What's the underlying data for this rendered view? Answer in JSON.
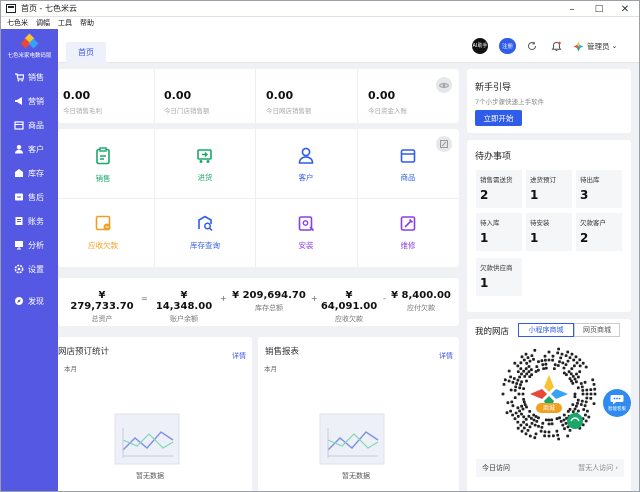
{
  "window": {
    "title": "首页 - 七色米云"
  },
  "menubar": [
    "七色米",
    "调幅",
    "工具",
    "帮助"
  ],
  "brand": {
    "name": "七色米家电数码版"
  },
  "sidebar": {
    "items": [
      {
        "label": "销售",
        "icon": "cart-icon"
      },
      {
        "label": "营销",
        "icon": "megaphone-icon"
      },
      {
        "label": "商品",
        "icon": "box-icon"
      },
      {
        "label": "客户",
        "icon": "user-icon"
      },
      {
        "label": "库存",
        "icon": "warehouse-icon"
      },
      {
        "label": "售后",
        "icon": "service-icon"
      },
      {
        "label": "账务",
        "icon": "ledger-icon"
      },
      {
        "label": "分析",
        "icon": "chart-icon"
      },
      {
        "label": "设置",
        "icon": "gear-icon"
      },
      {
        "label": "发现",
        "icon": "compass-icon"
      }
    ]
  },
  "tabs": [
    {
      "label": "首页"
    }
  ],
  "topbar": {
    "ai_label": "AI助手",
    "register_label": "注册",
    "user": "管理员"
  },
  "stats": [
    {
      "value": "0.00",
      "label": "今日销售毛利"
    },
    {
      "value": "0.00",
      "label": "今日门店销售额"
    },
    {
      "value": "0.00",
      "label": "今日网店销售额"
    },
    {
      "value": "0.00",
      "label": "今日资金入账"
    }
  ],
  "quick": [
    {
      "label": "销售",
      "color": "#1aa86a",
      "icon": "clipboard-icon"
    },
    {
      "label": "进货",
      "color": "#1aa86a",
      "icon": "truck-icon"
    },
    {
      "label": "客户",
      "color": "#2f5ce8",
      "icon": "person-icon"
    },
    {
      "label": "商品",
      "color": "#2f5ce8",
      "icon": "product-box-icon"
    },
    {
      "label": "应收欠款",
      "color": "#f0a020",
      "icon": "receivable-icon"
    },
    {
      "label": "库存查询",
      "color": "#2f5ce8",
      "icon": "stock-search-icon"
    },
    {
      "label": "安装",
      "color": "#8a3fe0",
      "icon": "install-icon"
    },
    {
      "label": "维修",
      "color": "#8a3fe0",
      "icon": "repair-icon"
    }
  ],
  "balance": {
    "items": [
      {
        "value": "¥ 279,733.70",
        "label": "总资产"
      },
      {
        "value": "¥ 14,348.00",
        "label": "账户余额"
      },
      {
        "value": "¥ 209,694.70",
        "label": "库存总额"
      },
      {
        "value": "¥ 64,091.00",
        "label": "应收欠款"
      },
      {
        "value": "¥ 8,400.00",
        "label": "应付欠款"
      }
    ],
    "ops": [
      "=",
      "+",
      "+",
      "-"
    ]
  },
  "panels": [
    {
      "title": "网店预订统计",
      "more": "详情",
      "sub": "本月",
      "empty": "暂无数据"
    },
    {
      "title": "销售报表",
      "more": "详情",
      "sub": "本月",
      "empty": "暂无数据"
    }
  ],
  "guide": {
    "title": "新手引导",
    "sub": "7个小步骤快速上手软件",
    "button": "立即开始"
  },
  "todo": {
    "title": "待办事项",
    "items": [
      {
        "label": "销售需送货",
        "value": "2"
      },
      {
        "label": "进货预订",
        "value": "1"
      },
      {
        "label": "待出库",
        "value": "3"
      },
      {
        "label": "待入库",
        "value": "1"
      },
      {
        "label": "待安装",
        "value": "1"
      },
      {
        "label": "欠款客户",
        "value": "2"
      },
      {
        "label": "欠款供应商",
        "value": "1"
      }
    ]
  },
  "shop": {
    "title": "我的网店",
    "tabs": [
      "小程序商城",
      "网页商城"
    ],
    "badge": "商城",
    "visits_label": "今日访问",
    "visits_value": "暂无人访问",
    "service_label": "智能客服"
  },
  "colors": {
    "sidebar": "#5558e3",
    "primary": "#2f5ce8",
    "green": "#1aa86a",
    "orange": "#f0a020",
    "purple": "#8a3fe0"
  }
}
